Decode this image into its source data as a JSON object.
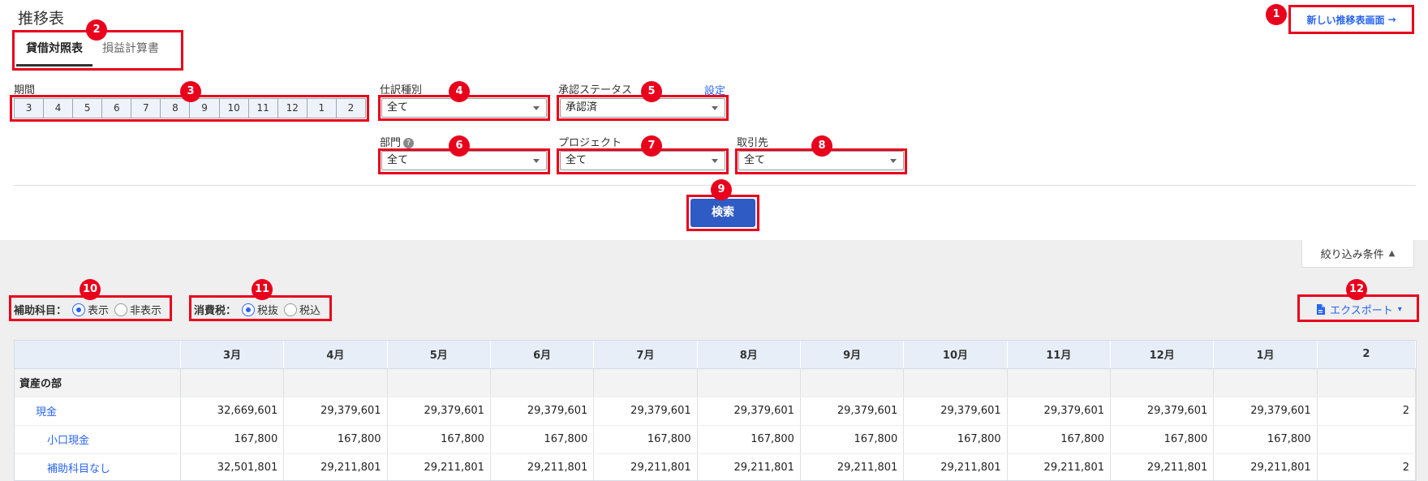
{
  "page": {
    "title": "推移表"
  },
  "header": {
    "new_screen_button": "新しい推移表画面",
    "new_screen_arrow": "→"
  },
  "tabs": [
    {
      "label": "貸借対照表",
      "active": true
    },
    {
      "label": "損益計算書",
      "active": false
    }
  ],
  "filters": {
    "period": {
      "label": "期間",
      "months": [
        "3",
        "4",
        "5",
        "6",
        "7",
        "8",
        "9",
        "10",
        "11",
        "12",
        "1",
        "2"
      ]
    },
    "journal_type": {
      "label": "仕訳種別",
      "value": "全て"
    },
    "approval_status": {
      "label": "承認ステータス",
      "value": "承認済",
      "settings_link": "設定"
    },
    "department": {
      "label": "部門",
      "help": "?",
      "value": "全て"
    },
    "project": {
      "label": "プロジェクト",
      "value": "全て"
    },
    "partner": {
      "label": "取引先",
      "value": "全て"
    },
    "search_button": "検索",
    "toggle": {
      "label": "絞り込み条件",
      "icon": "▲"
    }
  },
  "options": {
    "sub_account": {
      "label": "補助科目：",
      "choices": [
        "表示",
        "非表示"
      ],
      "selected": 0
    },
    "consumption_tax": {
      "label": "消費税：",
      "choices": [
        "税抜",
        "税込"
      ],
      "selected": 0
    }
  },
  "export": {
    "label": "エクスポート",
    "icon": "file-icon",
    "caret": "▾"
  },
  "table": {
    "columns": [
      "3月",
      "4月",
      "5月",
      "6月",
      "7月",
      "8月",
      "9月",
      "10月",
      "11月",
      "12月",
      "1月",
      "2"
    ],
    "rows": [
      {
        "type": "section",
        "name": "資産の部",
        "values": []
      },
      {
        "type": "account",
        "level": 1,
        "name": "現金",
        "values": [
          "32,669,601",
          "29,379,601",
          "29,379,601",
          "29,379,601",
          "29,379,601",
          "29,379,601",
          "29,379,601",
          "29,379,601",
          "29,379,601",
          "29,379,601",
          "29,379,601",
          "2"
        ]
      },
      {
        "type": "account",
        "level": 2,
        "name": "小口現金",
        "values": [
          "167,800",
          "167,800",
          "167,800",
          "167,800",
          "167,800",
          "167,800",
          "167,800",
          "167,800",
          "167,800",
          "167,800",
          "167,800",
          ""
        ]
      },
      {
        "type": "account",
        "level": 2,
        "name": "補助科目なし",
        "values": [
          "32,501,801",
          "29,211,801",
          "29,211,801",
          "29,211,801",
          "29,211,801",
          "29,211,801",
          "29,211,801",
          "29,211,801",
          "29,211,801",
          "29,211,801",
          "29,211,801",
          "2"
        ]
      }
    ]
  },
  "annotations": [
    "1",
    "2",
    "3",
    "4",
    "5",
    "6",
    "7",
    "8",
    "9",
    "10",
    "11",
    "12"
  ]
}
